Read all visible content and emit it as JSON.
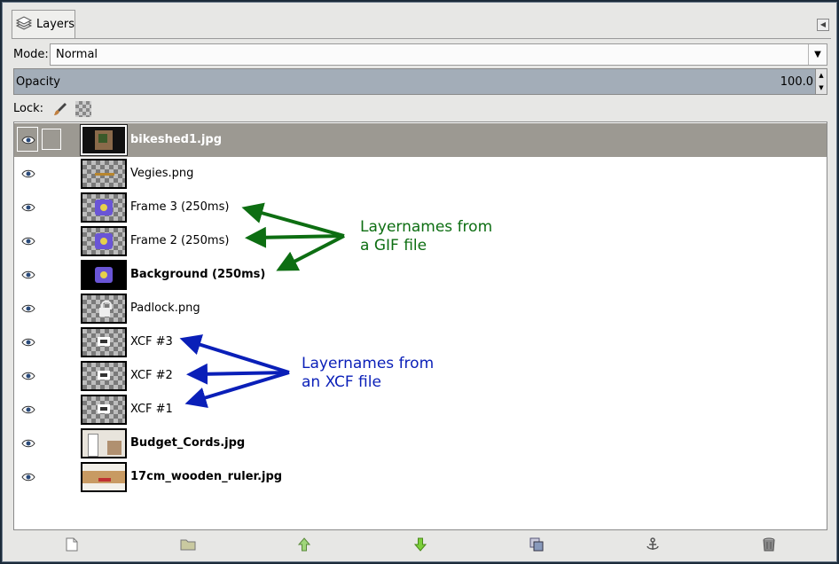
{
  "panel": {
    "tab_label": "Layers",
    "mode_label": "Mode:",
    "mode_value": "Normal",
    "opacity_label": "Opacity",
    "opacity_value": "100.0",
    "lock_label": "Lock:"
  },
  "layers": [
    {
      "name": "bikeshed1.jpg",
      "bold": true,
      "selected": true,
      "thumb": "photo-bikeshed"
    },
    {
      "name": "Vegies.png",
      "bold": false,
      "selected": false,
      "thumb": "checker-vegies"
    },
    {
      "name": "Frame 3 (250ms)",
      "bold": false,
      "selected": false,
      "thumb": "checker-frame"
    },
    {
      "name": "Frame 2 (250ms)",
      "bold": false,
      "selected": false,
      "thumb": "checker-frame"
    },
    {
      "name": "Background (250ms)",
      "bold": true,
      "selected": false,
      "thumb": "black-frame"
    },
    {
      "name": "Padlock.png",
      "bold": false,
      "selected": false,
      "thumb": "checker-padlock"
    },
    {
      "name": "XCF #3",
      "bold": false,
      "selected": false,
      "thumb": "checker-xcf"
    },
    {
      "name": "XCF #2",
      "bold": false,
      "selected": false,
      "thumb": "checker-xcf"
    },
    {
      "name": "XCF #1",
      "bold": false,
      "selected": false,
      "thumb": "checker-xcf"
    },
    {
      "name": "Budget_Cords.jpg",
      "bold": true,
      "selected": false,
      "thumb": "photo-cords"
    },
    {
      "name": "17cm_wooden_ruler.jpg",
      "bold": true,
      "selected": false,
      "thumb": "photo-ruler"
    }
  ],
  "toolbar": {
    "buttons": [
      "new-layer-icon",
      "new-layer-group-icon",
      "raise-layer-icon",
      "lower-layer-icon",
      "duplicate-layer-icon",
      "anchor-layer-icon",
      "delete-layer-icon"
    ]
  },
  "annotations": {
    "gif": {
      "line1": "Layernames from",
      "line2": "a GIF file",
      "color": "#0d6e12"
    },
    "xcf": {
      "line1": "Layernames from",
      "line2": "an XCF file",
      "color": "#0a1fb8"
    }
  },
  "colors": {
    "selected_row": "#9c9992",
    "opacity_bar": "#a3adb8"
  }
}
